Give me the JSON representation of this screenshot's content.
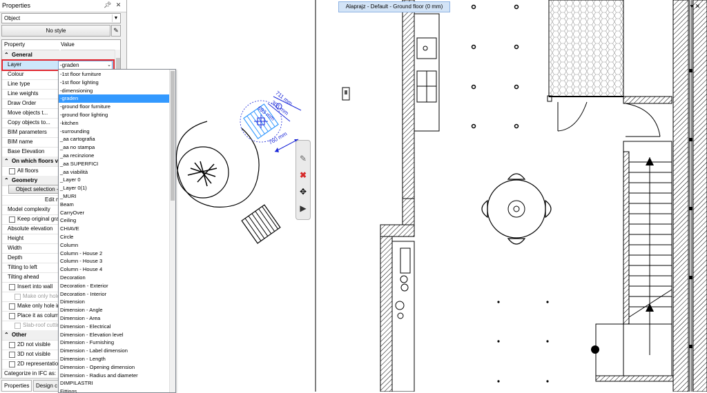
{
  "panel": {
    "title": "Properties",
    "object_select": "Object",
    "style_button": "No style",
    "col_property": "Property",
    "col_value": "Value",
    "sections": {
      "general": "General",
      "floors": "On which floors vi",
      "geometry": "Geometry",
      "other": "Other"
    },
    "rows": {
      "layer": "Layer",
      "layer_value": "-graden",
      "colour": "Colour",
      "line_type": "Line type",
      "line_weights": "Line weights",
      "draw_order": "Draw Order",
      "move_objects": "Move objects t...",
      "copy_objects": "Copy objects to...",
      "bim_params": "BIM parameters",
      "bim_name": "BIM name",
      "base_elev": "Base Elevation",
      "all_floors": "All floors",
      "object_selection": "Object selection ->",
      "edit_mode": "Edit m",
      "model_complexity": "Model complexity",
      "keep_original": "Keep original grap",
      "abs_elev": "Absolute elevation",
      "height": "Height",
      "width": "Width",
      "depth": "Depth",
      "tilt_left": "Tilting to left",
      "tilt_ahead": "Tilting ahead",
      "insert_wall": "Insert into wall",
      "make_only_hole1": "Make only hole",
      "make_only_hole2": "Make only hole in",
      "place_column": "Place it as column",
      "slab_roof": "Slab-roof cuttin",
      "not_visible_2d": "2D not visible",
      "not_visible_3d": "3D not visible",
      "repr_2d": "2D representation",
      "ifc": "Categorize in IFC as:"
    },
    "tabs": {
      "properties": "Properties",
      "design": "Design c"
    }
  },
  "layer_options": [
    "-1st floor furniture",
    "-1st floor lighting",
    "-dimensioning",
    "-graden",
    "-ground floor furniture",
    "-ground floor lighting",
    "-kitchen",
    "-surrounding",
    "_aa cartografia",
    "_aa no stampa",
    "_aa recinzione",
    "_aa SUPERFICI",
    "_aa viabilità",
    "_Layer 0",
    "_Layer 0(1)",
    "_MURI",
    "Beam",
    "CarryOver",
    "Ceiling",
    "CHIAVE",
    "Circle",
    "Column",
    "Column - House 2",
    "Column - House 3",
    "Column - House 4",
    "Decoration",
    "Decoration - Exterior",
    "Decoration - Interior",
    "Dimension",
    "Dimension - Angle",
    "Dimension - Area",
    "Dimension - Electrical",
    "Dimension - Elevation level",
    "Dimension - Furnishing",
    "Dimension - Label dimension",
    "Dimension - Length",
    "Dimension - Opening dimension",
    "Dimension - Radius and diameter",
    "DIMPILASTRI",
    "Fittings"
  ],
  "selected_layer_index": 3,
  "view": {
    "title": "Alaprajz - Default - Ground floor (0 mm)"
  },
  "dimensions": {
    "d1": "711 mm",
    "d2": "305 mm",
    "d3": "693 mm",
    "d4": "760 mm"
  },
  "toolbar_icons": [
    "pencil-icon",
    "delete-icon",
    "move-icon",
    "arrow-right-icon"
  ],
  "colors": {
    "selection": "#3399ff",
    "highlight": "#e0262e",
    "dimension": "#1a27d8"
  }
}
